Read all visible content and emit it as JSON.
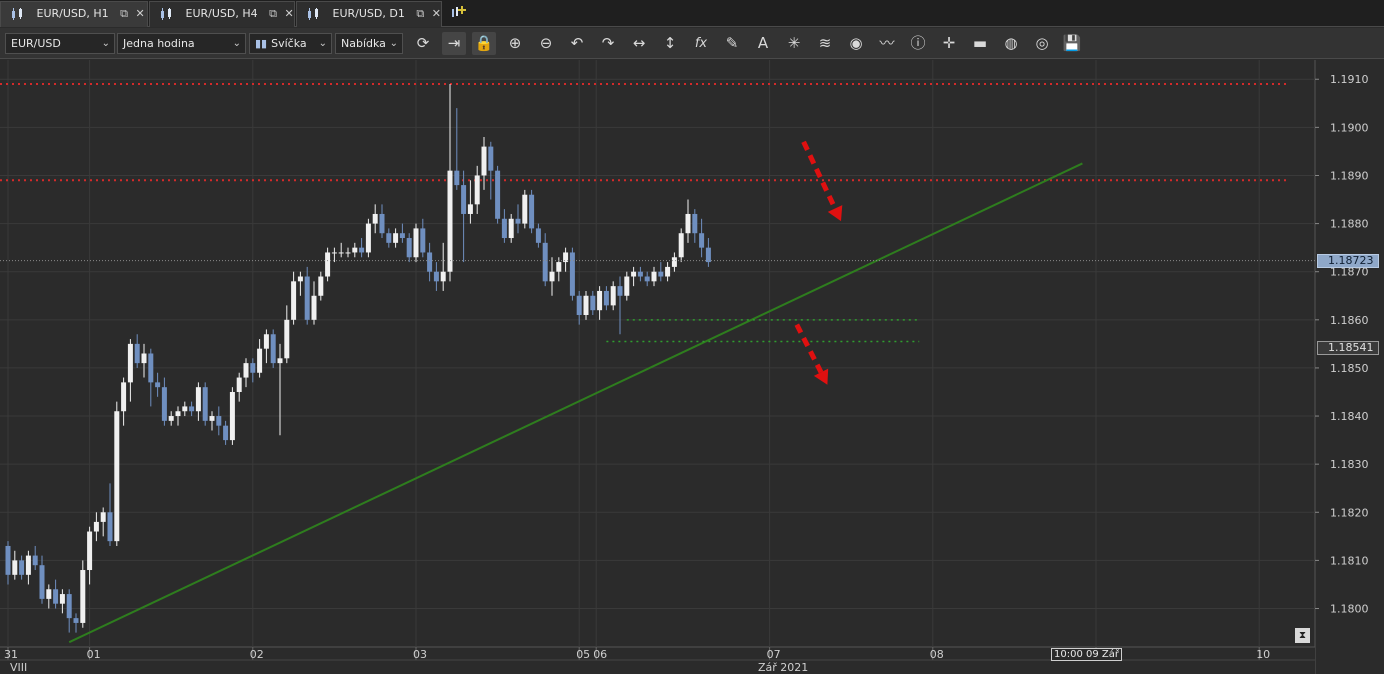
{
  "tabs": [
    {
      "label": "EUR/USD, H1",
      "active": true
    },
    {
      "label": "EUR/USD, H4",
      "active": false
    },
    {
      "label": "EUR/USD, D1",
      "active": false
    }
  ],
  "tab_icons": {
    "popout": "popout-icon",
    "close": "close-icon",
    "add": "add-chart-icon"
  },
  "toolbar": {
    "instrument": "EUR/USD",
    "period": "Jedna hodina",
    "chart_type": "Svíčka",
    "offer_side": "Nabídka",
    "tools": [
      {
        "name": "refresh-icon",
        "glyph": "⟳"
      },
      {
        "name": "shift-chart-icon",
        "glyph": "⇥"
      },
      {
        "name": "lock-icon",
        "glyph": "🔒"
      },
      {
        "name": "zoom-in-icon",
        "glyph": "⊕"
      },
      {
        "name": "zoom-out-icon",
        "glyph": "⊖"
      },
      {
        "name": "undo-icon",
        "glyph": "↶"
      },
      {
        "name": "redo-icon",
        "glyph": "↷"
      },
      {
        "name": "horizontal-line-icon",
        "glyph": "↔"
      },
      {
        "name": "vertical-line-icon",
        "glyph": "↕"
      },
      {
        "name": "indicators-icon",
        "glyph": "fx"
      },
      {
        "name": "pencil-icon",
        "glyph": "✎"
      },
      {
        "name": "text-icon",
        "glyph": "A"
      },
      {
        "name": "crosshair-tools-icon",
        "glyph": "✳"
      },
      {
        "name": "layers-icon",
        "glyph": "≋"
      },
      {
        "name": "eye-icon",
        "glyph": "◉"
      },
      {
        "name": "pattern-icon",
        "glyph": "〰"
      },
      {
        "name": "info-icon",
        "glyph": "ⓘ"
      },
      {
        "name": "cursor-icon",
        "glyph": "✛"
      },
      {
        "name": "ruler-icon",
        "glyph": "▬"
      },
      {
        "name": "paint-icon",
        "glyph": "◍"
      },
      {
        "name": "settings-icon",
        "glyph": "◎"
      },
      {
        "name": "save-icon",
        "glyph": "💾"
      }
    ]
  },
  "chart_data": {
    "type": "candlestick",
    "symbol": "EUR/USD",
    "timeframe": "H1",
    "ylim": [
      1.1792,
      1.1914
    ],
    "y_ticks": [
      "1.1800",
      "1.1810",
      "1.1820",
      "1.1830",
      "1.1840",
      "1.1850",
      "1.1860",
      "1.1870",
      "1.1880",
      "1.1890",
      "1.1900",
      "1.1910"
    ],
    "x_ticks": [
      {
        "label": "31",
        "x": 0.0
      },
      {
        "label": "01",
        "x": 12.0
      },
      {
        "label": "02",
        "x": 36.0
      },
      {
        "label": "03",
        "x": 60.0
      },
      {
        "label": "05",
        "x": 84.0
      },
      {
        "label": "06",
        "x": 86.5
      },
      {
        "label": "07",
        "x": 112.0
      },
      {
        "label": "08",
        "x": 136.0
      },
      {
        "label": "09",
        "x": 160.0
      },
      {
        "label": "10",
        "x": 184.0
      }
    ],
    "x_sublabels": [
      {
        "label": "VIII",
        "x": 0.0
      },
      {
        "label": "Zář 2021",
        "x": 110.0
      }
    ],
    "candles": [
      [
        1.1813,
        1.1814,
        1.1805,
        1.1807
      ],
      [
        1.1807,
        1.1812,
        1.1806,
        1.181
      ],
      [
        1.181,
        1.1811,
        1.1806,
        1.1807
      ],
      [
        1.1807,
        1.1812,
        1.1805,
        1.1811
      ],
      [
        1.1811,
        1.1813,
        1.1808,
        1.1809
      ],
      [
        1.1809,
        1.1811,
        1.1801,
        1.1802
      ],
      [
        1.1802,
        1.1805,
        1.18,
        1.1804
      ],
      [
        1.1804,
        1.1806,
        1.18,
        1.1801
      ],
      [
        1.1801,
        1.1804,
        1.1799,
        1.1803
      ],
      [
        1.1803,
        1.1804,
        1.1795,
        1.1798
      ],
      [
        1.1798,
        1.1799,
        1.1795,
        1.1797
      ],
      [
        1.1797,
        1.181,
        1.1796,
        1.1808
      ],
      [
        1.1808,
        1.1817,
        1.1805,
        1.1816
      ],
      [
        1.1816,
        1.182,
        1.1814,
        1.1818
      ],
      [
        1.1818,
        1.1821,
        1.1815,
        1.182
      ],
      [
        1.182,
        1.1826,
        1.1813,
        1.1814
      ],
      [
        1.1814,
        1.1843,
        1.1813,
        1.1841
      ],
      [
        1.1841,
        1.1848,
        1.1838,
        1.1847
      ],
      [
        1.1847,
        1.1856,
        1.1843,
        1.1855
      ],
      [
        1.1855,
        1.1857,
        1.185,
        1.1851
      ],
      [
        1.1851,
        1.1855,
        1.1848,
        1.1853
      ],
      [
        1.1853,
        1.1854,
        1.1842,
        1.1847
      ],
      [
        1.1847,
        1.1849,
        1.1844,
        1.1846
      ],
      [
        1.1846,
        1.1848,
        1.1838,
        1.1839
      ],
      [
        1.1839,
        1.1841,
        1.1838,
        1.184
      ],
      [
        1.184,
        1.1842,
        1.1838,
        1.1841
      ],
      [
        1.1841,
        1.1843,
        1.184,
        1.1842
      ],
      [
        1.1842,
        1.1843,
        1.184,
        1.1841
      ],
      [
        1.1841,
        1.1847,
        1.1839,
        1.1846
      ],
      [
        1.1846,
        1.1847,
        1.1838,
        1.1839
      ],
      [
        1.1839,
        1.1841,
        1.1837,
        1.184
      ],
      [
        1.184,
        1.1842,
        1.1836,
        1.1838
      ],
      [
        1.1838,
        1.1839,
        1.1834,
        1.1835
      ],
      [
        1.1835,
        1.1846,
        1.1834,
        1.1845
      ],
      [
        1.1845,
        1.1849,
        1.1843,
        1.1848
      ],
      [
        1.1848,
        1.1852,
        1.1846,
        1.1851
      ],
      [
        1.1851,
        1.1852,
        1.1847,
        1.1849
      ],
      [
        1.1849,
        1.1856,
        1.1848,
        1.1854
      ],
      [
        1.1854,
        1.1858,
        1.1851,
        1.1857
      ],
      [
        1.1857,
        1.1858,
        1.185,
        1.1851
      ],
      [
        1.1851,
        1.1855,
        1.1836,
        1.1852
      ],
      [
        1.1852,
        1.1863,
        1.1851,
        1.186
      ],
      [
        1.186,
        1.187,
        1.1859,
        1.1868
      ],
      [
        1.1868,
        1.187,
        1.1865,
        1.1869
      ],
      [
        1.1869,
        1.1871,
        1.1859,
        1.186
      ],
      [
        1.186,
        1.1868,
        1.1859,
        1.1865
      ],
      [
        1.1865,
        1.187,
        1.1864,
        1.1869
      ],
      [
        1.1869,
        1.1875,
        1.1868,
        1.1874
      ],
      [
        1.1874,
        1.1875,
        1.1872,
        1.1874
      ],
      [
        1.1874,
        1.1876,
        1.1873,
        1.1874
      ],
      [
        1.1874,
        1.1875,
        1.1873,
        1.1874
      ],
      [
        1.1874,
        1.1876,
        1.1873,
        1.1875
      ],
      [
        1.1875,
        1.1877,
        1.1873,
        1.1874
      ],
      [
        1.1874,
        1.1881,
        1.1873,
        1.188
      ],
      [
        1.188,
        1.1884,
        1.1878,
        1.1882
      ],
      [
        1.1882,
        1.1884,
        1.1877,
        1.1878
      ],
      [
        1.1878,
        1.1879,
        1.1875,
        1.1876
      ],
      [
        1.1876,
        1.1879,
        1.1875,
        1.1878
      ],
      [
        1.1878,
        1.188,
        1.1876,
        1.1877
      ],
      [
        1.1877,
        1.1878,
        1.1872,
        1.1873
      ],
      [
        1.1873,
        1.188,
        1.1872,
        1.1879
      ],
      [
        1.1879,
        1.1881,
        1.1873,
        1.1874
      ],
      [
        1.1874,
        1.1876,
        1.1868,
        1.187
      ],
      [
        1.187,
        1.1872,
        1.1866,
        1.1868
      ],
      [
        1.1868,
        1.1876,
        1.1866,
        1.187
      ],
      [
        1.187,
        1.1909,
        1.1868,
        1.1891
      ],
      [
        1.1891,
        1.1904,
        1.1887,
        1.1888
      ],
      [
        1.1888,
        1.1891,
        1.1872,
        1.1882
      ],
      [
        1.1882,
        1.1889,
        1.188,
        1.1884
      ],
      [
        1.1884,
        1.1892,
        1.1882,
        1.189
      ],
      [
        1.189,
        1.1898,
        1.1887,
        1.1896
      ],
      [
        1.1896,
        1.1897,
        1.1885,
        1.1891
      ],
      [
        1.1891,
        1.1892,
        1.188,
        1.1881
      ],
      [
        1.1881,
        1.1883,
        1.1876,
        1.1877
      ],
      [
        1.1877,
        1.1882,
        1.1876,
        1.1881
      ],
      [
        1.1881,
        1.1884,
        1.1878,
        1.188
      ],
      [
        1.188,
        1.1887,
        1.1879,
        1.1886
      ],
      [
        1.1886,
        1.1887,
        1.1878,
        1.1879
      ],
      [
        1.1879,
        1.188,
        1.1875,
        1.1876
      ],
      [
        1.1876,
        1.1878,
        1.1867,
        1.1868
      ],
      [
        1.1868,
        1.1873,
        1.1865,
        1.187
      ],
      [
        1.187,
        1.1873,
        1.1868,
        1.1872
      ],
      [
        1.1872,
        1.1875,
        1.187,
        1.1874
      ],
      [
        1.1874,
        1.1875,
        1.1864,
        1.1865
      ],
      [
        1.1865,
        1.1866,
        1.1859,
        1.1861
      ],
      [
        1.1861,
        1.1866,
        1.186,
        1.1865
      ],
      [
        1.1865,
        1.1866,
        1.1861,
        1.1862
      ],
      [
        1.1862,
        1.1867,
        1.186,
        1.1866
      ],
      [
        1.1866,
        1.1867,
        1.1862,
        1.1863
      ],
      [
        1.1863,
        1.1868,
        1.1862,
        1.1867
      ],
      [
        1.1867,
        1.1869,
        1.1857,
        1.1865
      ],
      [
        1.1865,
        1.187,
        1.1864,
        1.1869
      ],
      [
        1.1869,
        1.1871,
        1.1867,
        1.187
      ],
      [
        1.187,
        1.1871,
        1.1868,
        1.1869
      ],
      [
        1.1869,
        1.187,
        1.1867,
        1.1868
      ],
      [
        1.1868,
        1.1871,
        1.1867,
        1.187
      ],
      [
        1.187,
        1.1872,
        1.1868,
        1.1869
      ],
      [
        1.1869,
        1.1872,
        1.1868,
        1.1871
      ],
      [
        1.1871,
        1.1874,
        1.187,
        1.1873
      ],
      [
        1.1873,
        1.1879,
        1.1872,
        1.1878
      ],
      [
        1.1878,
        1.1885,
        1.1876,
        1.1882
      ],
      [
        1.1882,
        1.1883,
        1.1876,
        1.1878
      ],
      [
        1.1878,
        1.1881,
        1.1873,
        1.1875
      ],
      [
        1.1875,
        1.1877,
        1.1871,
        1.1872
      ]
    ],
    "resistance_levels": [
      1.1909,
      1.1889
    ],
    "support_levels": [
      {
        "price": 1.186,
        "from": 91,
        "to": 134
      },
      {
        "price": 1.18555,
        "from": 88,
        "to": 134
      }
    ],
    "trendline": {
      "x1": 9,
      "y1": 1.1793,
      "x2": 158,
      "y2": 1.18925
    },
    "current_price_bid": "1.18723",
    "current_price_marker": "1.18541",
    "cursor_time": "10:00 09 Zář",
    "annotations": [
      {
        "type": "arrow",
        "color": "#e01010",
        "from": [
          117,
          1.1897
        ],
        "to": [
          122.5,
          1.18805
        ]
      },
      {
        "type": "arrow",
        "color": "#e01010",
        "from": [
          116,
          1.1859
        ],
        "to": [
          120.5,
          1.18465
        ]
      }
    ]
  },
  "colors": {
    "background": "#2b2b2b",
    "grid": "#3a3a3a",
    "bull_candle": "#f0f0f0",
    "bear_candle": "#6f8fc0",
    "resistance": "#d42a2a",
    "support": "#2f9e2f",
    "trendline": "#2e7d1e"
  }
}
